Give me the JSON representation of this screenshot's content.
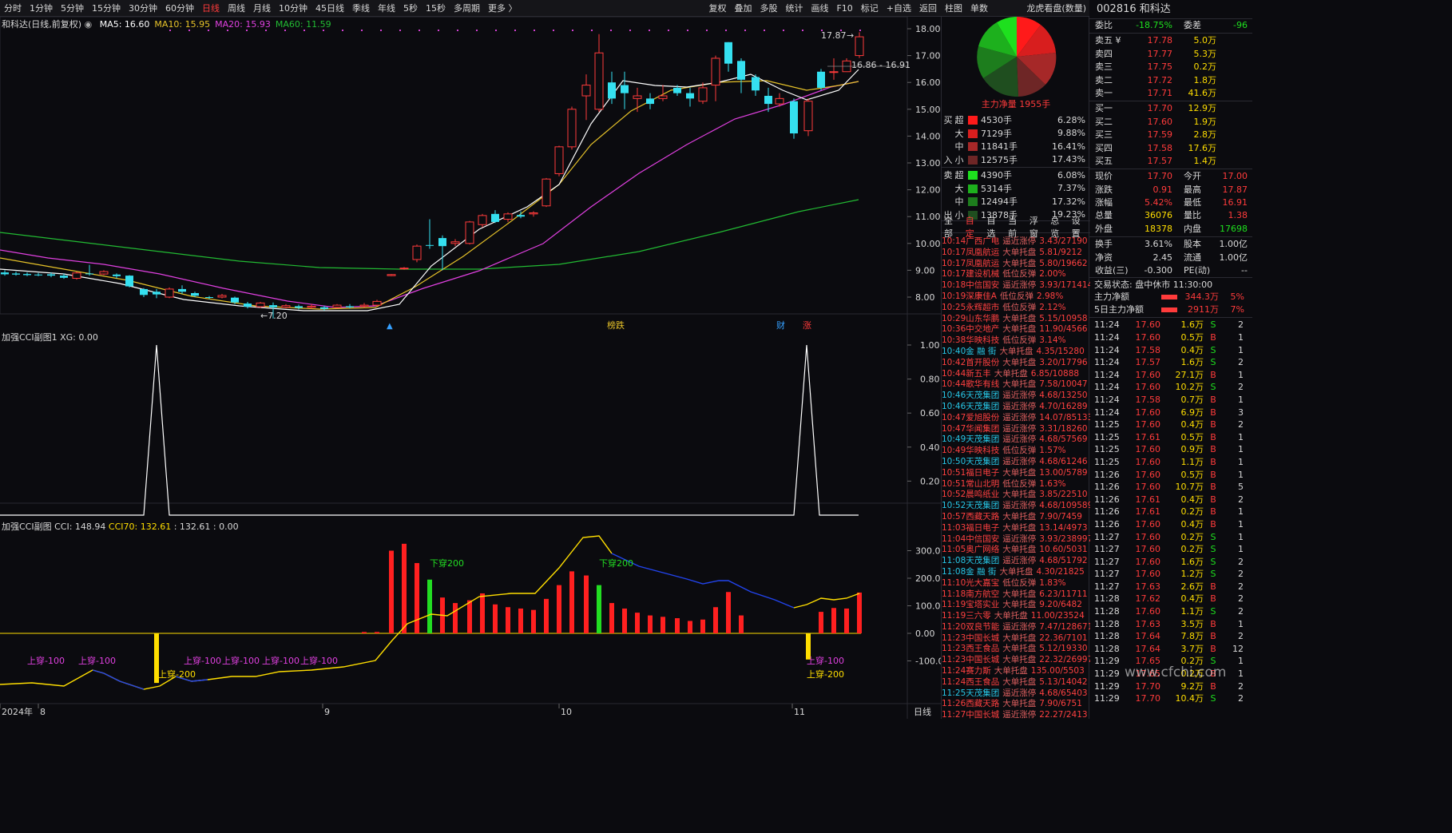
{
  "menubar": {
    "items": [
      "分时",
      "1分钟",
      "5分钟",
      "15分钟",
      "30分钟",
      "60分钟",
      "日线",
      "周线",
      "月线",
      "10分钟",
      "45日线",
      "季线",
      "年线",
      "5秒",
      "15秒",
      "多周期",
      "更多 〉"
    ],
    "active": "日线",
    "right": [
      "复权",
      "叠加",
      "多股",
      "统计",
      "画线",
      "F10",
      "标记",
      "+自选",
      "返回"
    ]
  },
  "mid_top": {
    "tabs": [
      "柱图",
      "单数"
    ],
    "title": "龙虎看盘(数量)"
  },
  "main": {
    "title": "和科达(日线,前复权)",
    "ma": [
      {
        "label": "MA5: 16.60",
        "color": "#ffffff"
      },
      {
        "label": "MA10: 15.95",
        "color": "#e6c229"
      },
      {
        "label": "MA20: 15.93",
        "color": "#e040e0"
      },
      {
        "label": "MA60: 11.59",
        "color": "#22bb33"
      }
    ],
    "yticks": [
      "18.00",
      "17.00",
      "16.00",
      "15.00",
      "14.00",
      "13.00",
      "12.00",
      "11.00",
      "10.00",
      "9.00",
      "8.00"
    ],
    "high_label": "17.87",
    "range_label": "16.86 - 16.91",
    "low_label": "←7.20",
    "markers": [
      "榜跌",
      "财",
      "涨"
    ]
  },
  "sub1": {
    "title": "加强CCI副图1  XG: 0.00",
    "yticks": [
      "1.00",
      "0.80",
      "0.60",
      "0.40",
      "0.20"
    ]
  },
  "sub2": {
    "title": "加强CCI副图  CCI: 148.94",
    "cci70": "CCI70: 132.61",
    "vals": ": 132.61  : 0.00",
    "yticks": [
      "300.0",
      "200.0",
      "100.0",
      "0.00",
      "-100.0"
    ],
    "labels": {
      "down200_1": "下穿200",
      "down200_2": "下穿200",
      "up100": [
        "上穿-100",
        "上穿-100",
        "上穿-100",
        "上穿-100",
        "上穿-100",
        "上穿-100",
        "上穿-100"
      ],
      "up200_1": "上穿-200",
      "up200_2": "上穿-200"
    }
  },
  "xaxis": {
    "labels": [
      "2024年",
      "8",
      "9",
      "10",
      "11"
    ],
    "period": "日线"
  },
  "pie": {
    "label": "主力净量 1955手"
  },
  "flow": [
    {
      "side": "买",
      "size": "超",
      "hands": "4530手",
      "pct": "6.28%",
      "color": "#ff1a1a"
    },
    {
      "side": "",
      "size": "大",
      "hands": "7129手",
      "pct": "9.88%",
      "color": "#d81e1e"
    },
    {
      "side": "",
      "size": "中",
      "hands": "11841手",
      "pct": "16.41%",
      "color": "#a62828"
    },
    {
      "side": "入",
      "size": "小",
      "hands": "12575手",
      "pct": "17.43%",
      "color": "#6e2626"
    },
    {
      "side": "卖",
      "size": "超",
      "hands": "4390手",
      "pct": "6.08%",
      "color": "#1ee01e"
    },
    {
      "side": "",
      "size": "大",
      "hands": "5314手",
      "pct": "7.37%",
      "color": "#1db01d"
    },
    {
      "side": "",
      "size": "中",
      "hands": "12494手",
      "pct": "17.32%",
      "color": "#1d7d1d"
    },
    {
      "side": "出",
      "size": "小",
      "hands": "13878手",
      "pct": "19.23%",
      "color": "#1f4e1f"
    }
  ],
  "tabs2": {
    "left": [
      "全部",
      "自定",
      "自选",
      "当前"
    ],
    "active": "自定",
    "right": [
      "浮窗",
      "总览",
      "设置"
    ]
  },
  "news": [
    {
      "t": "10:14",
      "n": "广西广电",
      "e": "逼近涨停",
      "v": "3.43/27190",
      "c": 0
    },
    {
      "t": "10:17",
      "n": "凤凰航运",
      "e": "大单托盘",
      "v": "5.81/9212",
      "c": 0
    },
    {
      "t": "10:17",
      "n": "凤凰航运",
      "e": "大单托盘",
      "v": "5.80/19662",
      "c": 0
    },
    {
      "t": "10:17",
      "n": "建设机械",
      "e": "低位反弹",
      "v": "2.00%",
      "c": 0
    },
    {
      "t": "10:18",
      "n": "中信国安",
      "e": "逼近涨停",
      "v": "3.93/171414",
      "c": 0
    },
    {
      "t": "10:19",
      "n": "深康佳A",
      "e": "低位反弹",
      "v": "2.98%",
      "c": 0
    },
    {
      "t": "10:25",
      "n": "永辉超市",
      "e": "低位反弹",
      "v": "2.12%",
      "c": 0
    },
    {
      "t": "10:29",
      "n": "山东华鹏",
      "e": "大单托盘",
      "v": "5.15/10958",
      "c": 0
    },
    {
      "t": "10:36",
      "n": "中交地产",
      "e": "大单托盘",
      "v": "11.90/4566",
      "c": 0
    },
    {
      "t": "10:38",
      "n": "华映科技",
      "e": "低位反弹",
      "v": "3.14%",
      "c": 0
    },
    {
      "t": "10:40",
      "n": "金 融 街",
      "e": "大单托盘",
      "v": "4.35/15280",
      "c": 1
    },
    {
      "t": "10:42",
      "n": "首开股份",
      "e": "大单托盘",
      "v": "3.20/17796",
      "c": 0
    },
    {
      "t": "10:44",
      "n": "新五丰",
      "e": "大单托盘",
      "v": "6.85/10888",
      "c": 0
    },
    {
      "t": "10:44",
      "n": "歌华有线",
      "e": "大单托盘",
      "v": "7.58/10047",
      "c": 0
    },
    {
      "t": "10:46",
      "n": "天茂集团",
      "e": "逼近涨停",
      "v": "4.68/13250",
      "c": 1
    },
    {
      "t": "10:46",
      "n": "天茂集团",
      "e": "逼近涨停",
      "v": "4.70/16289",
      "c": 1
    },
    {
      "t": "10:47",
      "n": "爱旭股份",
      "e": "逼近涨停",
      "v": "14.07/85133",
      "c": 0
    },
    {
      "t": "10:47",
      "n": "华闻集团",
      "e": "逼近涨停",
      "v": "3.31/18260",
      "c": 0
    },
    {
      "t": "10:49",
      "n": "天茂集团",
      "e": "逼近涨停",
      "v": "4.68/57569",
      "c": 1
    },
    {
      "t": "10:49",
      "n": "华映科技",
      "e": "低位反弹",
      "v": "1.57%",
      "c": 0
    },
    {
      "t": "10:50",
      "n": "天茂集团",
      "e": "逼近涨停",
      "v": "4.68/61246",
      "c": 1
    },
    {
      "t": "10:51",
      "n": "福日电子",
      "e": "大单托盘",
      "v": "13.00/5789",
      "c": 0
    },
    {
      "t": "10:51",
      "n": "常山北明",
      "e": "低位反弹",
      "v": "1.63%",
      "c": 0
    },
    {
      "t": "10:52",
      "n": "晨鸣纸业",
      "e": "大单托盘",
      "v": "3.85/22510",
      "c": 0
    },
    {
      "t": "10:52",
      "n": "天茂集团",
      "e": "逼近涨停",
      "v": "4.68/109589",
      "c": 1
    },
    {
      "t": "10:57",
      "n": "西藏天路",
      "e": "大单托盘",
      "v": "7.90/7459",
      "c": 0
    },
    {
      "t": "11:03",
      "n": "福日电子",
      "e": "大单托盘",
      "v": "13.14/4973",
      "c": 0
    },
    {
      "t": "11:04",
      "n": "中信国安",
      "e": "逼近涨停",
      "v": "3.93/238997",
      "c": 0
    },
    {
      "t": "11:05",
      "n": "奥广网络",
      "e": "大单托盘",
      "v": "10.60/5031",
      "c": 0
    },
    {
      "t": "11:08",
      "n": "天茂集团",
      "e": "逼近涨停",
      "v": "4.68/51792",
      "c": 1
    },
    {
      "t": "11:08",
      "n": "金 融 街",
      "e": "大单托盘",
      "v": "4.30/21825",
      "c": 1
    },
    {
      "t": "11:10",
      "n": "光大嘉宝",
      "e": "低位反弹",
      "v": "1.83%",
      "c": 0
    },
    {
      "t": "11:18",
      "n": "南方航空",
      "e": "大单托盘",
      "v": "6.23/11711",
      "c": 0
    },
    {
      "t": "11:19",
      "n": "宝塔实业",
      "e": "大单托盘",
      "v": "9.20/6482",
      "c": 0
    },
    {
      "t": "11:19",
      "n": "三六零",
      "e": "大单托盘",
      "v": "11.00/23524",
      "c": 0
    },
    {
      "t": "11:20",
      "n": "双良节能",
      "e": "逼近涨停",
      "v": "7.47/128671",
      "c": 0
    },
    {
      "t": "11:23",
      "n": "中国长城",
      "e": "大单托盘",
      "v": "22.36/7101",
      "c": 0
    },
    {
      "t": "11:23",
      "n": "西王食品",
      "e": "大单托盘",
      "v": "5.12/19330",
      "c": 0
    },
    {
      "t": "11:23",
      "n": "中国长城",
      "e": "大单托盘",
      "v": "22.32/26997",
      "c": 0
    },
    {
      "t": "11:24",
      "n": "赛力斯",
      "e": "大单托盘",
      "v": "135.00/5503",
      "c": 0
    },
    {
      "t": "11:24",
      "n": "西王食品",
      "e": "大单托盘",
      "v": "5.13/14042",
      "c": 0
    },
    {
      "t": "11:25",
      "n": "天茂集团",
      "e": "逼近涨停",
      "v": "4.68/65403",
      "c": 1
    },
    {
      "t": "11:26",
      "n": "西藏天路",
      "e": "大单托盘",
      "v": "7.90/6751",
      "c": 0
    },
    {
      "t": "11:27",
      "n": "中国长城",
      "e": "逼近涨停",
      "v": "22.27/2413",
      "c": 0
    }
  ],
  "right": {
    "title": "002816 和科达",
    "wb": [
      "委比",
      "-18.75%",
      "委差",
      "-96"
    ],
    "asks": [
      [
        "卖五 ¥",
        "17.78",
        "5.0万"
      ],
      [
        "卖四",
        "17.77",
        "5.3万"
      ],
      [
        "卖三",
        "17.75",
        "0.2万"
      ],
      [
        "卖二",
        "17.72",
        "1.8万"
      ],
      [
        "卖一",
        "17.71",
        "41.6万"
      ]
    ],
    "bids": [
      [
        "买一",
        "17.70",
        "12.9万"
      ],
      [
        "买二",
        "17.60",
        "1.9万"
      ],
      [
        "买三",
        "17.59",
        "2.8万"
      ],
      [
        "买四",
        "17.58",
        "17.6万"
      ],
      [
        "买五",
        "17.57",
        "1.4万"
      ]
    ],
    "quote": [
      [
        "现价",
        "17.70",
        "今开",
        "17.00"
      ],
      [
        "涨跌",
        "0.91",
        "最高",
        "17.87"
      ],
      [
        "涨幅",
        "5.42%",
        "最低",
        "16.91"
      ],
      [
        "总量",
        "36076",
        "量比",
        "1.38"
      ],
      [
        "外盘",
        "18378",
        "内盘",
        "17698"
      ]
    ],
    "stats": [
      [
        "换手",
        "3.61%",
        "股本",
        "1.00亿"
      ],
      [
        "净资",
        "2.45",
        "流通",
        "1.00亿"
      ],
      [
        "收益(三)",
        "-0.300",
        "PE(动)",
        "--"
      ]
    ],
    "status": "交易状态: 盘中休市 11:30:00",
    "net": [
      [
        "主力净额",
        "344.3万",
        "5%"
      ],
      [
        "5日主力净额",
        "2911万",
        "7%"
      ]
    ],
    "ticks": [
      [
        "11:24",
        "17.60",
        "1.6万",
        "S",
        "2"
      ],
      [
        "11:24",
        "17.60",
        "0.5万",
        "B",
        "1"
      ],
      [
        "11:24",
        "17.58",
        "0.4万",
        "S",
        "1"
      ],
      [
        "11:24",
        "17.57",
        "1.6万",
        "S",
        "2"
      ],
      [
        "11:24",
        "17.60",
        "27.1万",
        "B",
        "1"
      ],
      [
        "11:24",
        "17.60",
        "10.2万",
        "S",
        "2"
      ],
      [
        "11:24",
        "17.58",
        "0.7万",
        "B",
        "1"
      ],
      [
        "11:24",
        "17.60",
        "6.9万",
        "B",
        "3"
      ],
      [
        "11:25",
        "17.60",
        "0.4万",
        "B",
        "2"
      ],
      [
        "11:25",
        "17.61",
        "0.5万",
        "B",
        "1"
      ],
      [
        "11:25",
        "17.60",
        "0.9万",
        "B",
        "1"
      ],
      [
        "11:25",
        "17.60",
        "1.1万",
        "B",
        "1"
      ],
      [
        "11:26",
        "17.60",
        "0.5万",
        "B",
        "1"
      ],
      [
        "11:26",
        "17.60",
        "10.7万",
        "B",
        "5"
      ],
      [
        "11:26",
        "17.61",
        "0.4万",
        "B",
        "2"
      ],
      [
        "11:26",
        "17.61",
        "0.2万",
        "B",
        "1"
      ],
      [
        "11:26",
        "17.60",
        "0.4万",
        "B",
        "1"
      ],
      [
        "11:27",
        "17.60",
        "0.2万",
        "S",
        "1"
      ],
      [
        "11:27",
        "17.60",
        "0.2万",
        "S",
        "1"
      ],
      [
        "11:27",
        "17.60",
        "1.6万",
        "S",
        "2"
      ],
      [
        "11:27",
        "17.60",
        "1.2万",
        "S",
        "2"
      ],
      [
        "11:27",
        "17.63",
        "2.6万",
        "B",
        "2"
      ],
      [
        "11:28",
        "17.62",
        "0.4万",
        "B",
        "2"
      ],
      [
        "11:28",
        "17.60",
        "1.1万",
        "S",
        "2"
      ],
      [
        "11:28",
        "17.63",
        "3.5万",
        "B",
        "1"
      ],
      [
        "11:28",
        "17.64",
        "7.8万",
        "B",
        "2"
      ],
      [
        "11:28",
        "17.64",
        "3.7万",
        "B",
        "12"
      ],
      [
        "11:29",
        "17.65",
        "0.2万",
        "S",
        "1"
      ],
      [
        "11:29",
        "17.65",
        "0.2万",
        "B",
        "1"
      ],
      [
        "11:29",
        "17.70",
        "9.2万",
        "B",
        "2"
      ],
      [
        "11:29",
        "17.70",
        "10.4万",
        "S",
        "2"
      ]
    ]
  },
  "watermark": "www.cfchi.com",
  "colors": {
    "up": "#ff3b3b",
    "down": "#35e0f0",
    "bg": "#0b0b0f"
  }
}
